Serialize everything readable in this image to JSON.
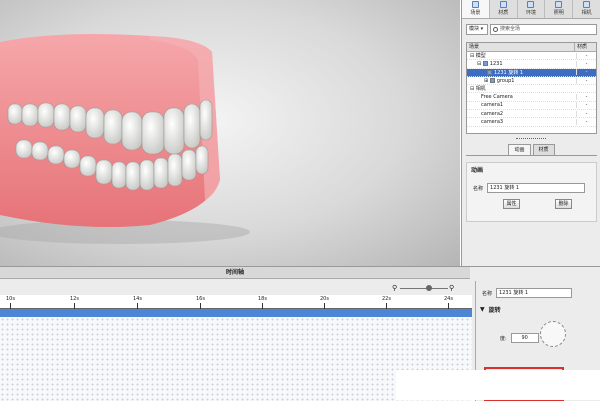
{
  "panel": {
    "tabs": [
      {
        "label": "场景",
        "icon": "scene-icon"
      },
      {
        "label": "材质",
        "icon": "material-icon"
      },
      {
        "label": "环境",
        "icon": "environment-icon"
      },
      {
        "label": "照明",
        "icon": "lighting-icon"
      },
      {
        "label": "相机",
        "icon": "camera-icon"
      }
    ],
    "filter_label": "模块",
    "search_placeholder": "搜索全场",
    "tree_header": {
      "name": "场景",
      "value": "材质"
    },
    "tree": [
      {
        "label": "模型",
        "level": 0,
        "checked": false,
        "selected": false
      },
      {
        "label": "1231",
        "level": 1,
        "checked": true,
        "selected": false
      },
      {
        "label": "1231 旋转 1",
        "level": 2,
        "checked": true,
        "selected": true
      },
      {
        "label": "group1",
        "level": 2,
        "checked": true,
        "selected": false
      },
      {
        "label": "相机",
        "level": 0,
        "checked": false,
        "selected": false
      },
      {
        "label": "Free Camera",
        "level": 1,
        "checked": false,
        "selected": false
      },
      {
        "label": "camera1",
        "level": 1,
        "checked": false,
        "selected": false
      },
      {
        "label": "camera2",
        "level": 1,
        "checked": false,
        "selected": false
      },
      {
        "label": "camera3",
        "level": 1,
        "checked": false,
        "selected": false
      }
    ],
    "prop_tabs": [
      "动画",
      "材质"
    ],
    "animation": {
      "section_title": "动画",
      "name_label": "名称",
      "name_value": "1231 旋转 1",
      "btn_props": "属性",
      "btn_delete": "删除"
    }
  },
  "timeline": {
    "title": "时间轴",
    "ticks": [
      "10s",
      "12s",
      "14s",
      "16s",
      "18s",
      "20s",
      "22s",
      "24s"
    ]
  },
  "inspector": {
    "name_label": "名称",
    "name_value": "1231 旋转 1",
    "section": "旋转",
    "degree_label": "度:",
    "degree_value": "90",
    "axis_label": "轴:",
    "axes": [
      "X",
      "Y",
      "Z"
    ],
    "selected_axis": "X"
  },
  "colors": {
    "selection": "#3d6cc0",
    "timeline_track": "#4d86d6",
    "highlight": "#d9302c",
    "gum": "#f08a8f"
  }
}
